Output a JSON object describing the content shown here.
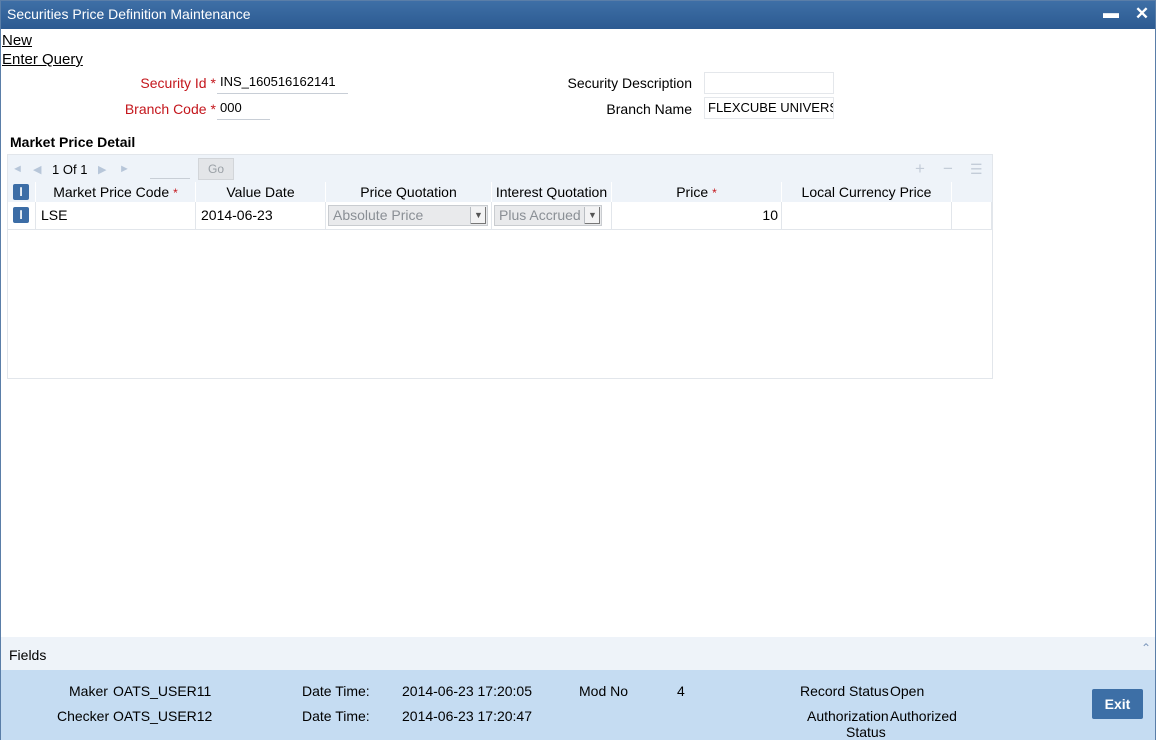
{
  "window": {
    "title": "Securities Price Definition Maintenance"
  },
  "toolbar": {
    "new_label": "New",
    "enter_query_label": "Enter Query"
  },
  "form": {
    "security_id": {
      "label": "Security Id",
      "value": "INS_160516162141"
    },
    "branch_code": {
      "label": "Branch Code",
      "value": "000"
    },
    "security_description": {
      "label": "Security Description",
      "value": ""
    },
    "branch_name": {
      "label": "Branch Name",
      "value": "FLEXCUBE UNIVERS"
    }
  },
  "market_price": {
    "section_title": "Market Price Detail",
    "pager": {
      "current": "1",
      "of_label": "Of",
      "total": "1"
    },
    "go_label": "Go",
    "columns": {
      "market_price_code": "Market Price Code",
      "value_date": "Value Date",
      "price_quotation": "Price Quotation",
      "interest_quotation": "Interest Quotation",
      "price": "Price",
      "local_currency_price": "Local Currency Price"
    },
    "rows": [
      {
        "market_price_code": "LSE",
        "value_date": "2014-06-23",
        "price_quotation": "Absolute Price",
        "interest_quotation": "Plus Accrued",
        "price": "10",
        "local_currency_price": ""
      }
    ]
  },
  "fields_bar": {
    "label": "Fields"
  },
  "footer": {
    "maker_label": "Maker",
    "maker": "OATS_USER11",
    "checker_label": "Checker",
    "checker": "OATS_USER12",
    "date_time_label": "Date Time:",
    "maker_date_time": "2014-06-23 17:20:05",
    "checker_date_time": "2014-06-23 17:20:47",
    "mod_no_label": "Mod No",
    "mod_no": "4",
    "record_status_label": "Record Status",
    "record_status": "Open",
    "auth_status_label_1": "Authorization",
    "auth_status_label_2": "Status",
    "auth_status": "Authorized",
    "exit_label": "Exit"
  },
  "colors": {
    "accent": "#3d6fa6",
    "required": "#c4161c",
    "footer_bg": "#c5dcf2",
    "grid_header_bg": "#eef3f9"
  }
}
